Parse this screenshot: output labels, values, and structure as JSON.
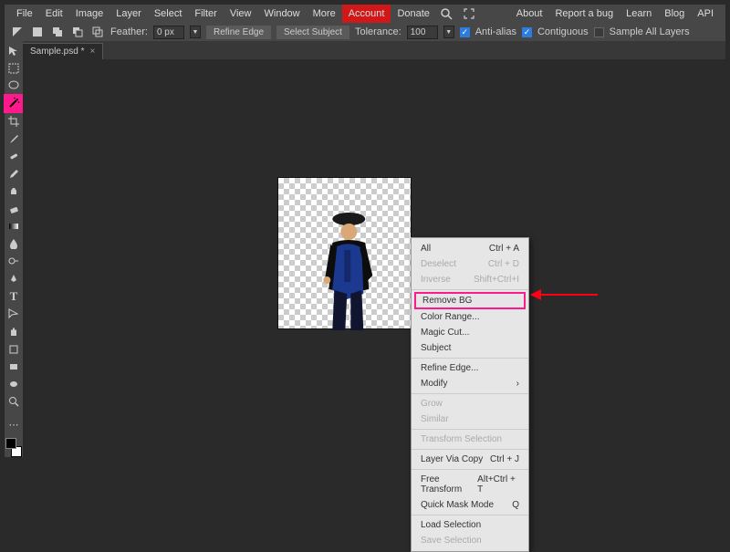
{
  "menubar": {
    "left": [
      "File",
      "Edit",
      "Image",
      "Layer",
      "Select",
      "Filter",
      "View",
      "Window",
      "More"
    ],
    "account": "Account",
    "donate": "Donate",
    "right": [
      "About",
      "Report a bug",
      "Learn",
      "Blog",
      "API"
    ]
  },
  "options": {
    "feather_label": "Feather:",
    "feather_value": "0 px",
    "refine_edge": "Refine Edge",
    "select_subject": "Select Subject",
    "tolerance_label": "Tolerance:",
    "tolerance_value": "100",
    "antialias": "Anti-alias",
    "contiguous": "Contiguous",
    "sample_all": "Sample All Layers"
  },
  "tab": {
    "name": "Sample.psd *",
    "close": "×"
  },
  "tools": [
    "move",
    "select-rect",
    "lasso",
    "wand",
    "crop",
    "eyedrop",
    "heal",
    "brush",
    "clone",
    "eraser",
    "gradient",
    "blur",
    "dodge",
    "pen",
    "text",
    "path",
    "hand",
    "shape",
    "rect",
    "ellipse",
    "zoom"
  ],
  "ctx": {
    "all": {
      "l": "All",
      "s": "Ctrl + A"
    },
    "deselect": {
      "l": "Deselect",
      "s": "Ctrl + D"
    },
    "inverse": {
      "l": "Inverse",
      "s": "Shift+Ctrl+I"
    },
    "removebg": {
      "l": "Remove BG"
    },
    "colorrange": {
      "l": "Color Range..."
    },
    "magiccut": {
      "l": "Magic Cut..."
    },
    "subject": {
      "l": "Subject"
    },
    "refine": {
      "l": "Refine Edge..."
    },
    "modify": {
      "l": "Modify",
      "s": "›"
    },
    "grow": {
      "l": "Grow"
    },
    "similar": {
      "l": "Similar"
    },
    "transform": {
      "l": "Transform Selection"
    },
    "layercopy": {
      "l": "Layer Via Copy",
      "s": "Ctrl + J"
    },
    "freetrans": {
      "l": "Free Transform",
      "s": "Alt+Ctrl + T"
    },
    "quickmask": {
      "l": "Quick Mask Mode",
      "s": "Q"
    },
    "load": {
      "l": "Load Selection"
    },
    "save": {
      "l": "Save Selection"
    }
  }
}
